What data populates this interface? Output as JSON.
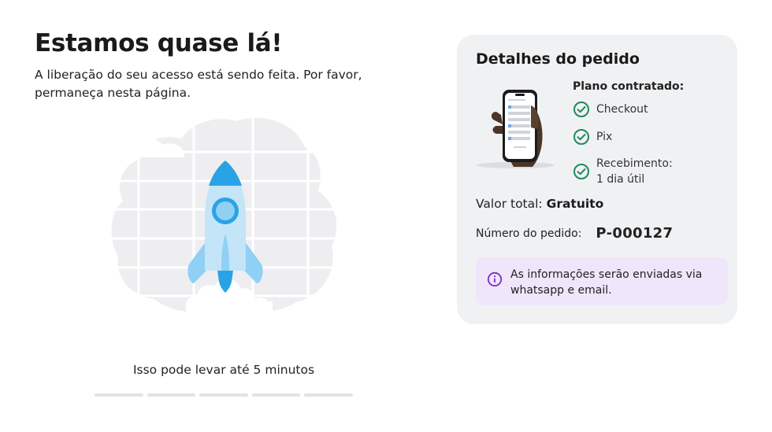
{
  "header": {
    "title": "Estamos quase lá!",
    "subtitle": "A liberação do seu acesso está sendo feita. Por favor, permaneça nesta página."
  },
  "illustration": {
    "icon": "rocket-icon"
  },
  "progress": {
    "text": "Isso pode levar até 5 minutos",
    "segments_total": 5,
    "segments_done": 0
  },
  "order": {
    "title": "Detalhes do pedido",
    "plan_label": "Plano contratado:",
    "plan_items": [
      {
        "label": "Checkout"
      },
      {
        "label": "Pix"
      },
      {
        "label": "Recebimento: 1 dia útil"
      }
    ],
    "total_label": "Valor total:",
    "total_value": "Gratuito",
    "order_number_label": "Número do pedido:",
    "order_number": "P-000127",
    "info_message": "As informações serão enviadas via whatsapp e email."
  },
  "colors": {
    "check": "#1f8a5b",
    "info_bg": "#efe6fb",
    "info_icon": "#7b2fbf",
    "rocket": "#29a3e6",
    "card_bg": "#f0f1f3"
  }
}
